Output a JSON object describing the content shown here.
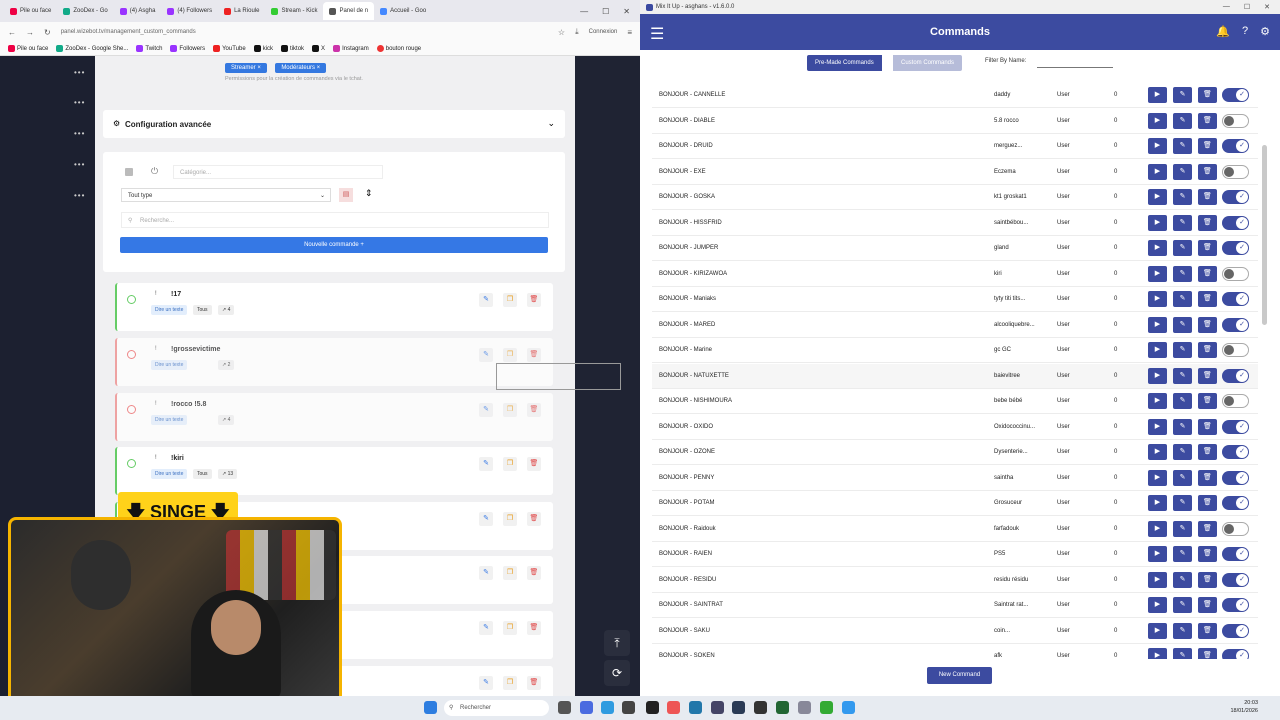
{
  "browser": {
    "tabs": [
      "Pile ou face",
      "ZooDex - Go",
      "(4) Asgha",
      "(4) Followers",
      "La Rioule",
      "Stream - Kick",
      "Panel de n",
      "Accueil - Goo"
    ],
    "url": "panel.wizebot.tv/management_custom_commands",
    "connexion": "Connexion",
    "bookmarks": [
      "Pile ou face",
      "ZooDex - Google She...",
      "Twitch",
      "Followers",
      "YouTube",
      "kick",
      "tiktok",
      "X",
      "Instagram",
      "bouton rouge"
    ]
  },
  "panel": {
    "chip_streamer": "Streamer",
    "chip_mods": "Modérateurs",
    "permissions_note": "Permissions pour la création de commandes via le tchat.",
    "advanced_title": "Configuration avancée",
    "category_placeholder": "Catégorie...",
    "type_select": "Tout type",
    "search_placeholder": "Recherche...",
    "new_command": "Nouvelle commande",
    "commands": [
      {
        "name": "!17",
        "type": "Dire un texte",
        "scope": "Tous",
        "count": "4",
        "on": true
      },
      {
        "name": "!grossevictime",
        "type": "Dire un texte",
        "scope": "",
        "count": "2",
        "on": false
      },
      {
        "name": "!rocco !5.8",
        "type": "Dire un texte",
        "scope": "",
        "count": "4",
        "on": false
      },
      {
        "name": "!kiri",
        "type": "Dire un texte",
        "scope": "Tous",
        "count": "13",
        "on": true
      }
    ]
  },
  "overlay": {
    "banner": "SINGE"
  },
  "app": {
    "window_title": "Mix It Up - asghans - v1.6.0.0",
    "header_title": "Commands",
    "tab_premade": "Pre-Made Commands",
    "tab_custom": "Custom Commands",
    "filter_label": "Filter By Name:",
    "new_command": "New Command",
    "rows": [
      {
        "name": "BONJOUR - CANNELLE",
        "response": "daddy",
        "perm": "User",
        "count": "0",
        "on": true
      },
      {
        "name": "BONJOUR - DIABLE",
        "response": "5.8 rocco",
        "perm": "User",
        "count": "0",
        "on": false
      },
      {
        "name": "BONJOUR - DRUID",
        "response": "merguez...",
        "perm": "User",
        "count": "0",
        "on": true
      },
      {
        "name": "BONJOUR - EXE",
        "response": "Eczema",
        "perm": "User",
        "count": "0",
        "on": false
      },
      {
        "name": "BONJOUR - GOSKA",
        "response": "kt1 groskat1",
        "perm": "User",
        "count": "0",
        "on": true
      },
      {
        "name": "BONJOUR - HISSFRID",
        "response": "saintbébou...",
        "perm": "User",
        "count": "0",
        "on": true
      },
      {
        "name": "BONJOUR - JUMPER",
        "response": "gland",
        "perm": "User",
        "count": "0",
        "on": true
      },
      {
        "name": "BONJOUR - KIRIZAWOA",
        "response": "kiri",
        "perm": "User",
        "count": "0",
        "on": false
      },
      {
        "name": "BONJOUR - Maniaks",
        "response": "tyty titi tits...",
        "perm": "User",
        "count": "0",
        "on": true
      },
      {
        "name": "BONJOUR - MARED",
        "response": "alcooliquebre...",
        "perm": "User",
        "count": "0",
        "on": true
      },
      {
        "name": "BONJOUR - Marine",
        "response": "gc GC",
        "perm": "User",
        "count": "0",
        "on": false
      },
      {
        "name": "BONJOUR - NATUXETTE",
        "response": "baievitree",
        "perm": "User",
        "count": "0",
        "on": true
      },
      {
        "name": "BONJOUR - NISHIMOURA",
        "response": "bebe bébé",
        "perm": "User",
        "count": "0",
        "on": false
      },
      {
        "name": "BONJOUR - OXIDO",
        "response": "Oxidococcinu...",
        "perm": "User",
        "count": "0",
        "on": true
      },
      {
        "name": "BONJOUR - OZONE",
        "response": "Dysenterie...",
        "perm": "User",
        "count": "0",
        "on": true
      },
      {
        "name": "BONJOUR - PENNY",
        "response": "saintha",
        "perm": "User",
        "count": "0",
        "on": true
      },
      {
        "name": "BONJOUR - POTAM",
        "response": "Grosuceur",
        "perm": "User",
        "count": "0",
        "on": true
      },
      {
        "name": "BONJOUR - Raidouk",
        "response": "farfadouk",
        "perm": "User",
        "count": "0",
        "on": false
      },
      {
        "name": "BONJOUR - RAIEN",
        "response": "PS5",
        "perm": "User",
        "count": "0",
        "on": true
      },
      {
        "name": "BONJOUR - RESIDU",
        "response": "residu résidu",
        "perm": "User",
        "count": "0",
        "on": true
      },
      {
        "name": "BONJOUR - SAINTRAT",
        "response": "Saintrat rat...",
        "perm": "User",
        "count": "0",
        "on": true
      },
      {
        "name": "BONJOUR - SAKU",
        "response": "coin...",
        "perm": "User",
        "count": "0",
        "on": true
      },
      {
        "name": "BONJOUR - SOKEN",
        "response": "afk",
        "perm": "User",
        "count": "0",
        "on": true
      }
    ]
  },
  "taskbar": {
    "search": "Rechercher",
    "time": "20:03",
    "date": "18/01/2026"
  }
}
